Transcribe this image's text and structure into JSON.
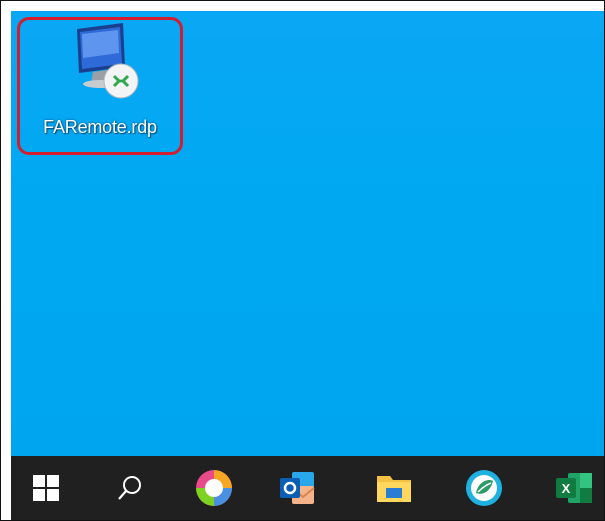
{
  "desktop": {
    "background_color": "#00a6f0",
    "highlight_color": "#d21f2f",
    "icons": [
      {
        "label": "FARemote.rdp",
        "icon": "remote-desktop-icon",
        "selected": true
      }
    ]
  },
  "taskbar": {
    "background_color": "#202020",
    "items": [
      {
        "icon": "windows-start-icon"
      },
      {
        "icon": "search-icon"
      },
      {
        "icon": "color-wheel-app-icon"
      },
      {
        "icon": "outlook-icon"
      },
      {
        "icon": "file-explorer-icon"
      },
      {
        "icon": "circular-app-icon"
      },
      {
        "icon": "excel-icon"
      }
    ]
  }
}
